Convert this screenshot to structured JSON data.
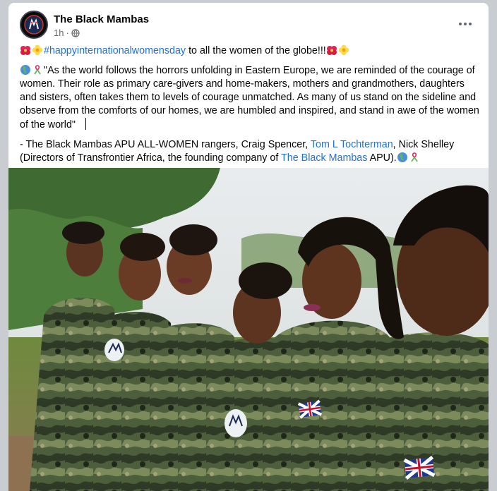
{
  "post": {
    "page_name": "The Black Mambas",
    "time": "1h",
    "audience_icon": "globe-icon",
    "line1": {
      "hashtag": "#happyinternationalwomensday",
      "text": " to all the women of the globe!!!"
    },
    "quote": "\"As the world follows the horrors unfolding in Eastern Europe, we are reminded of the courage of women. Their role as primary care-givers and home-makers, mothers and grandmothers, daughters and sisters, often takes them to levels of courage unmatched. As many of us stand on the sideline and observe from the comforts of our homes, we are  humbled and inspired, and stand in awe of the women of the world\"",
    "credit": {
      "part1": "- The Black Mambas APU ALL-WOMEN rangers, Craig Spencer, ",
      "mention1": "Tom L Tochterman",
      "part2": ", Nick Shelley (Directors of Transfrontier Africa, the founding company of ",
      "mention2": "The Black Mambas",
      "part3": " APU)."
    }
  },
  "photo": {
    "subject_count": 6
  },
  "colors": {
    "link": "#216fdb",
    "meta": "#65676b",
    "background": "#c9ccd1"
  }
}
